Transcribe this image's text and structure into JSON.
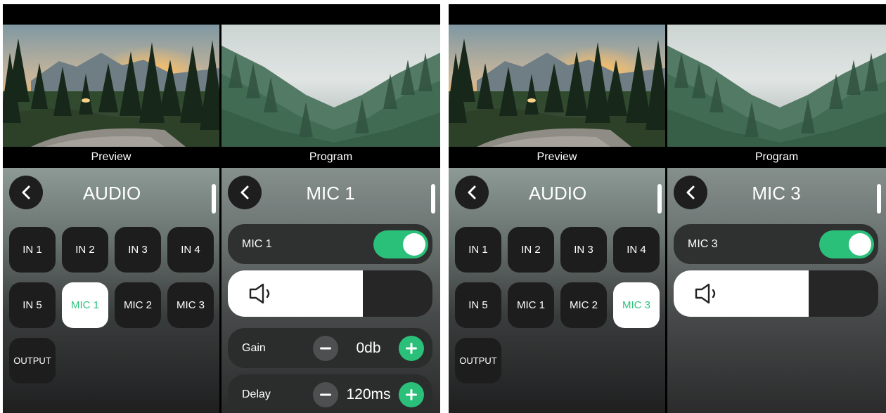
{
  "screens": [
    {
      "id": "left",
      "video": {
        "preview_label": "Preview",
        "program_label": "Program"
      },
      "audio_panel": {
        "title": "AUDIO",
        "back_icon": "chevron-left-icon",
        "sources": [
          "IN 1",
          "IN 2",
          "IN 3",
          "IN 4",
          "IN 5",
          "MIC 1",
          "MIC 2",
          "MIC 3",
          "OUTPUT"
        ],
        "selected": "MIC 1"
      },
      "detail_panel": {
        "title": "MIC 1",
        "back_icon": "chevron-left-icon",
        "toggle_label": "MIC 1",
        "toggle_on": true,
        "volume_icon": "speaker-icon",
        "volume_level_percent": 66,
        "gain_label": "Gain",
        "gain_value": "0db",
        "delay_label": "Delay",
        "delay_value": "120ms"
      }
    },
    {
      "id": "right",
      "video": {
        "preview_label": "Preview",
        "program_label": "Program"
      },
      "audio_panel": {
        "title": "AUDIO",
        "back_icon": "chevron-left-icon",
        "sources": [
          "IN 1",
          "IN 2",
          "IN 3",
          "IN 4",
          "IN 5",
          "MIC 1",
          "MIC 2",
          "MIC 3",
          "OUTPUT"
        ],
        "selected": "MIC 3"
      },
      "detail_panel": {
        "title": "MIC 3",
        "back_icon": "chevron-left-icon",
        "toggle_label": "MIC 3",
        "toggle_on": true,
        "volume_icon": "speaker-icon",
        "volume_level_percent": 66
      }
    }
  ],
  "colors": {
    "accent_green": "#2bc07a",
    "button_dark": "#1d1d1e",
    "active_button": "#ffffff"
  }
}
